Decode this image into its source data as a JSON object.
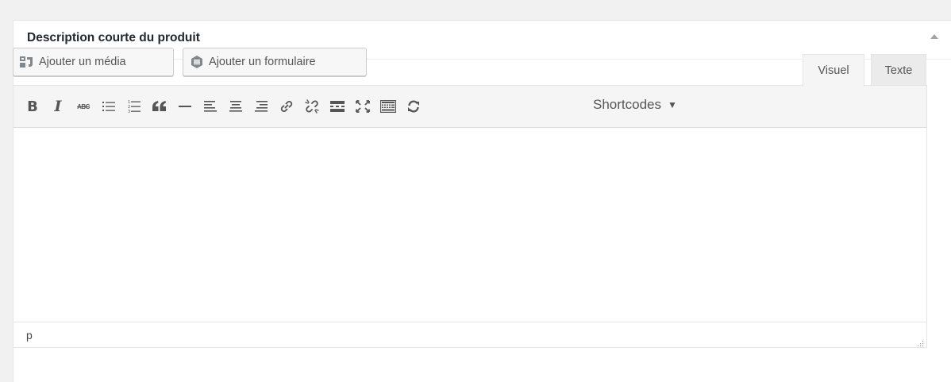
{
  "postbox": {
    "title": "Description courte du produit"
  },
  "media_buttons": {
    "add_media": "Ajouter un média",
    "add_form": "Ajouter un formulaire"
  },
  "tabs": {
    "visual": "Visuel",
    "text": "Texte"
  },
  "toolbar": {
    "bold": "B",
    "italic": "I",
    "strike": "ABC",
    "items": [
      "bold-icon",
      "italic-icon",
      "strikethrough-icon",
      "bullet-list-icon",
      "numbered-list-icon",
      "blockquote-icon",
      "horizontal-line-icon",
      "align-left-icon",
      "align-center-icon",
      "align-right-icon",
      "link-icon",
      "unlink-icon",
      "read-more-icon",
      "fullscreen-icon",
      "toolbar-toggle-icon",
      "refresh-icon"
    ],
    "shortcodes": "Shortcodes",
    "shortcodes_arrow": "▼"
  },
  "statusbar": {
    "path": "p"
  },
  "colors": {
    "background": "#f1f1f1",
    "toolbar_bg": "#f5f5f5",
    "icon": "#555555"
  }
}
